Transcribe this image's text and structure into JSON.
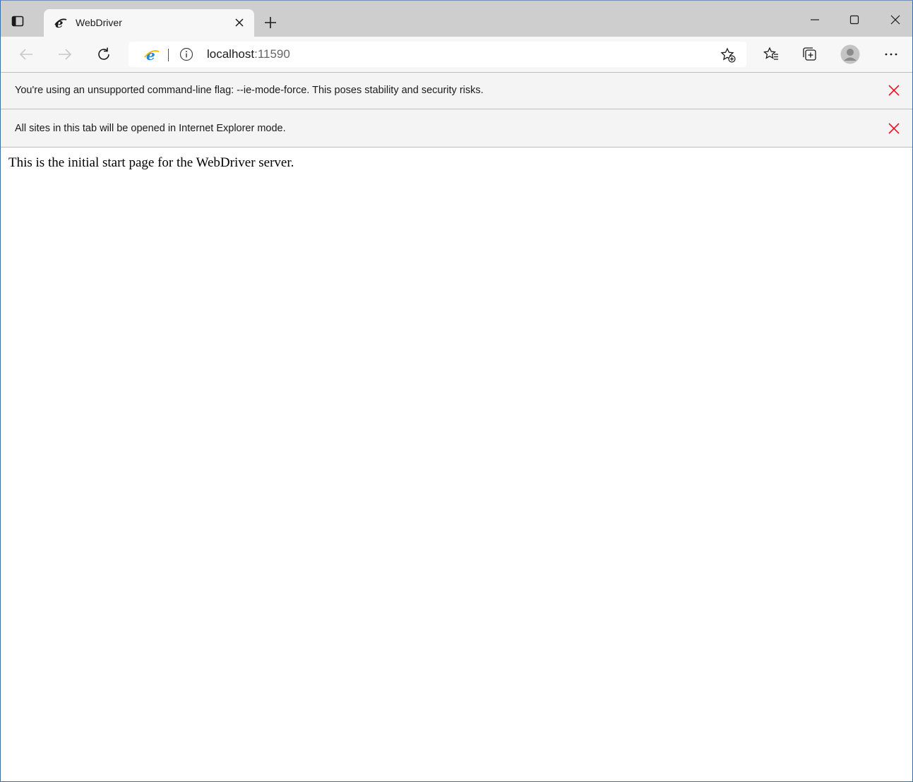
{
  "tab": {
    "title": "WebDriver"
  },
  "address_bar": {
    "host": "localhost",
    "port": ":11590"
  },
  "infobars": [
    {
      "text": "You're using an unsupported command-line flag: --ie-mode-force. This poses stability and security risks."
    },
    {
      "text": "All sites in this tab will be opened in Internet Explorer mode."
    }
  ],
  "page": {
    "body_text": "This is the initial start page for the WebDriver server."
  },
  "colors": {
    "tabstrip": "#cecece",
    "toolbar": "#f7f7f7",
    "infobar_close": "#e81123",
    "ie_blue": "#1e88e5"
  },
  "icons": [
    "tab-actions-icon",
    "ie-favicon-icon",
    "close-icon",
    "plus-icon",
    "minimize-icon",
    "maximize-icon",
    "back-arrow-icon",
    "forward-arrow-icon",
    "refresh-icon",
    "info-icon",
    "add-favorite-icon",
    "favorites-icon",
    "collections-icon",
    "profile-avatar-icon",
    "more-icon"
  ]
}
